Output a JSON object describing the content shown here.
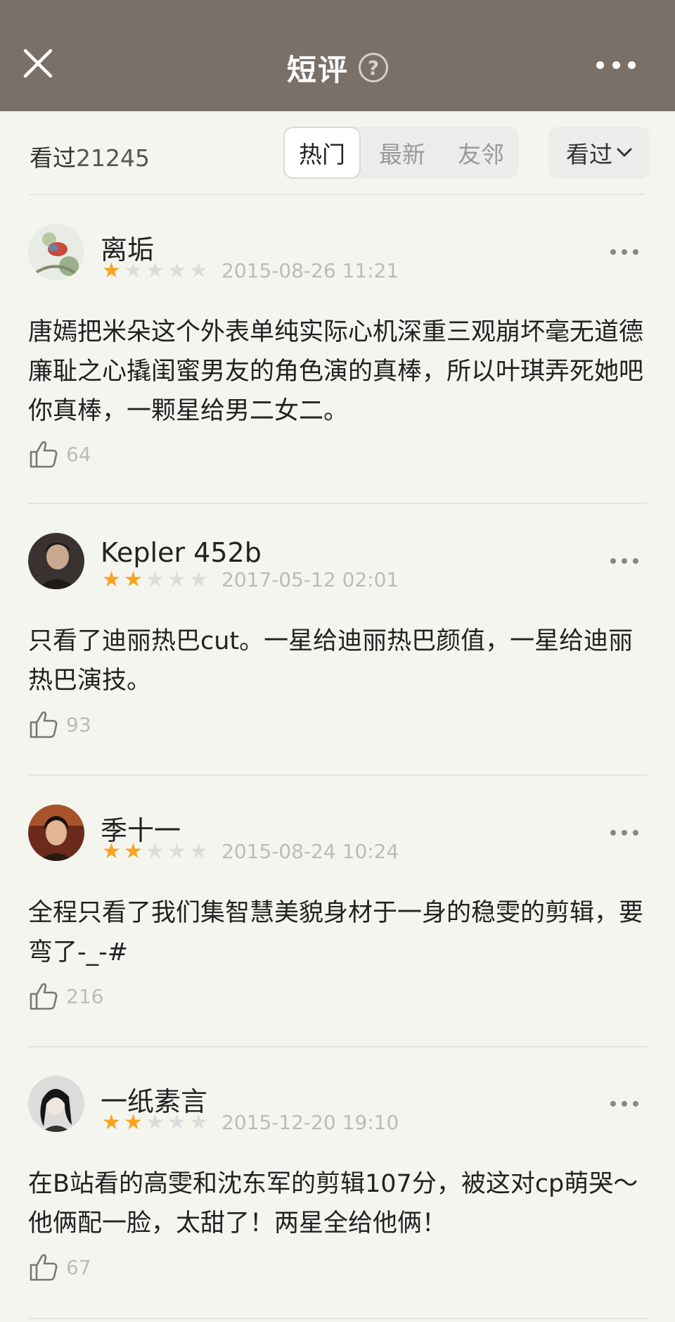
{
  "header": {
    "title": "短评",
    "help_glyph": "?"
  },
  "filter": {
    "watched_label": "看过",
    "watched_count": "21245",
    "tabs": [
      {
        "label": "热门",
        "active": true
      },
      {
        "label": "最新",
        "active": false
      },
      {
        "label": "友邻",
        "active": false
      }
    ],
    "dropdown_label": "看过"
  },
  "reviews": [
    {
      "user": "离垢",
      "rating": 1,
      "date": "2015-08-26 11:21",
      "content": "唐嫣把米朵这个外表单纯实际心机深重三观崩坏毫无道德廉耻之心撬闺蜜男友的角色演的真棒，所以叶琪弄死她吧你真棒，一颗星给男二女二。",
      "likes": "64"
    },
    {
      "user": "Kepler 452b",
      "rating": 2,
      "date": "2017-05-12 02:01",
      "content": "只看了迪丽热巴cut。一星给迪丽热巴颜值，一星给迪丽热巴演技。",
      "likes": "93"
    },
    {
      "user": "季十一",
      "rating": 2,
      "date": "2015-08-24 10:24",
      "content": "全程只看了我们集智慧美貌身材于一身的稳雯的剪辑，要弯了-_-#",
      "likes": "216"
    },
    {
      "user": "一纸素言",
      "rating": 2,
      "date": "2015-12-20 19:10",
      "content": "在B站看的高雯和沈东军的剪辑107分，被这对cp萌哭～他俩配一脸，太甜了！两星全给他俩！",
      "likes": "67"
    }
  ],
  "colors": {
    "header_bg": "#7a7068",
    "star_on": "#f7a320",
    "star_off": "#dcdcdc"
  }
}
